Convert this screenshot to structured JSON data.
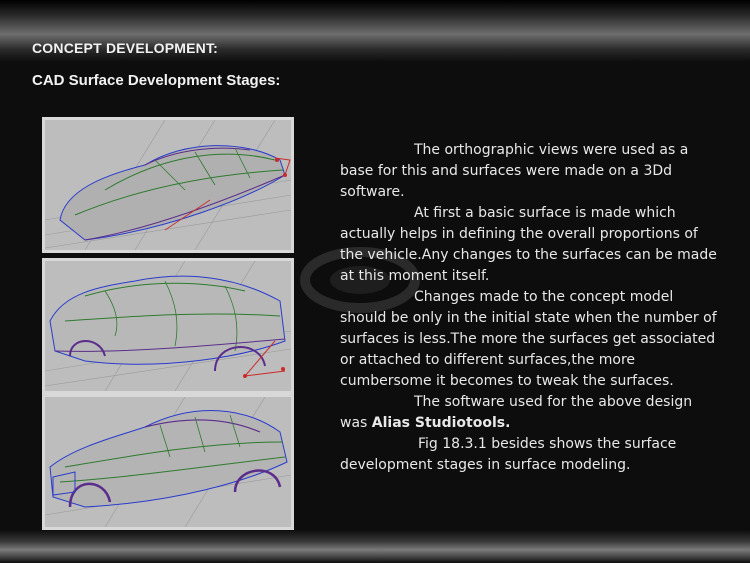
{
  "header": {
    "section_title": "CONCEPT DEVELOPMENT:",
    "subtitle": "CAD Surface Development Stages:"
  },
  "figures": [
    {
      "name": "stage-1-basic-surface"
    },
    {
      "name": "stage-2-associated-surfaces"
    },
    {
      "name": "stage-3-final-surfaces"
    }
  ],
  "body": {
    "p1": "The orthographic views were used as a base for this and surfaces were made on a 3Dd software.",
    "p2": "At first a basic surface is made which actually helps in defining the overall proportions of the vehicle.Any changes to the surfaces can be made at this moment itself.",
    "p3": "Changes made to the concept model should be only in the initial state when the number of surfaces is less.The more the surfaces get associated or attached to different surfaces,the more cumbersome it becomes to tweak the surfaces.",
    "p4_prefix": "The software used for the above design was ",
    "p4_software": "Alias Studiotools.",
    "p5": "Fig 18.3.1 besides shows the surface development stages in surface modeling."
  },
  "colors": {
    "background": "#0d0d0d",
    "text": "#e8e8e8",
    "viewport": "#bdbdbd",
    "wire_green": "#2f7a2f",
    "wire_purple": "#5b2d8a",
    "wire_red": "#cc2a2a",
    "wire_blue": "#2a3ccc"
  }
}
